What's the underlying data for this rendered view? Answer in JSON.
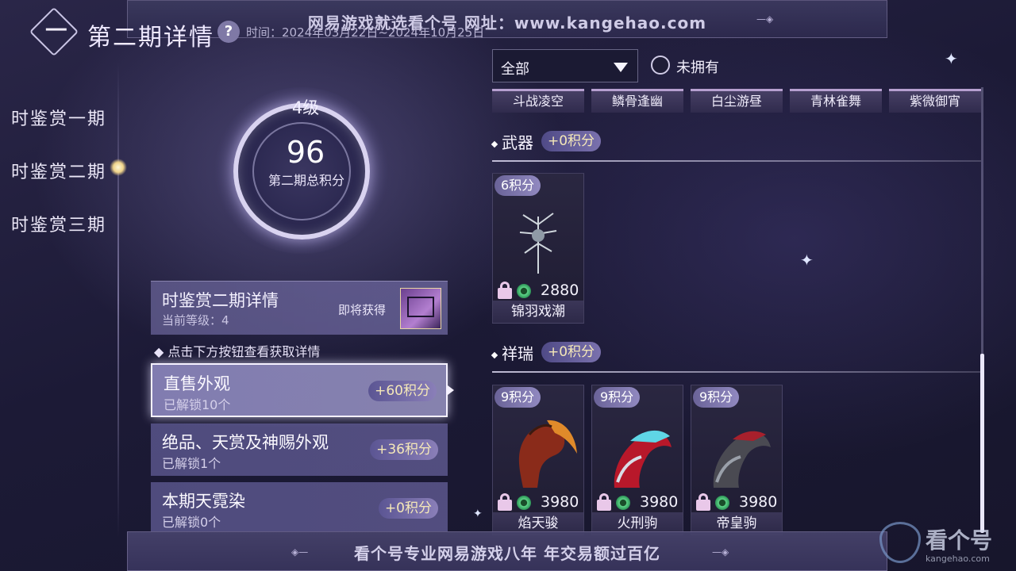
{
  "banner_top": {
    "text": "网易游戏就选看个号  网址：www.kangehao.com"
  },
  "header": {
    "title": "第二期详情",
    "help": "?",
    "time": "时间：2024年03月22日~2024年10月25日"
  },
  "nav": {
    "items": [
      {
        "label": "时鉴赏一期"
      },
      {
        "label": "时鉴赏二期"
      },
      {
        "label": "时鉴赏三期"
      }
    ],
    "active_index": 1
  },
  "score": {
    "level": "4级",
    "value": "96",
    "label": "第二期总积分"
  },
  "detail_card": {
    "title": "时鉴赏二期详情",
    "subtitle": "当前等级：4",
    "upcoming": "即将获得"
  },
  "tip": "点击下方按钮查看获取详情",
  "categories": [
    {
      "name": "直售外观",
      "status": "已解锁10个",
      "points": "+60积分",
      "active": true
    },
    {
      "name": "绝品、天赏及神赐外观",
      "status": "已解锁1个",
      "points": "+36积分",
      "active": false
    },
    {
      "name": "本期天霓染",
      "status": "已解锁0个",
      "points": "+0积分",
      "active": false
    }
  ],
  "filter": {
    "selected": "全部",
    "checkbox_label": "未拥有",
    "checkbox_checked": false
  },
  "top_row_names": [
    "斗战凌空",
    "鳞骨逢幽",
    "白尘游昼",
    "青林雀舞",
    "紫微御宵"
  ],
  "sections": [
    {
      "title": "武器",
      "points": "+0积分",
      "items": [
        {
          "points": "6积分",
          "price": "2880",
          "name": "锦羽戏潮",
          "icon": "weapon-icon"
        }
      ]
    },
    {
      "title": "祥瑞",
      "points": "+0积分",
      "items": [
        {
          "points": "9积分",
          "price": "3980",
          "name": "焰天骏",
          "icon": "horse-icon"
        },
        {
          "points": "9积分",
          "price": "3980",
          "name": "火刑驹",
          "icon": "mecha-mount-icon"
        },
        {
          "points": "9积分",
          "price": "3980",
          "name": "帝皇驹",
          "icon": "mecha-mount-icon"
        }
      ]
    }
  ],
  "banner_bottom": {
    "text": "看个号专业网易游戏八年  年交易额过百亿"
  },
  "watermark": {
    "text": "看个号",
    "url": "kangehao.com"
  },
  "colors": {
    "accent_gold": "#f5e8b8",
    "lock_pink": "#e9c8e9",
    "jade_green": "#5ed488"
  }
}
